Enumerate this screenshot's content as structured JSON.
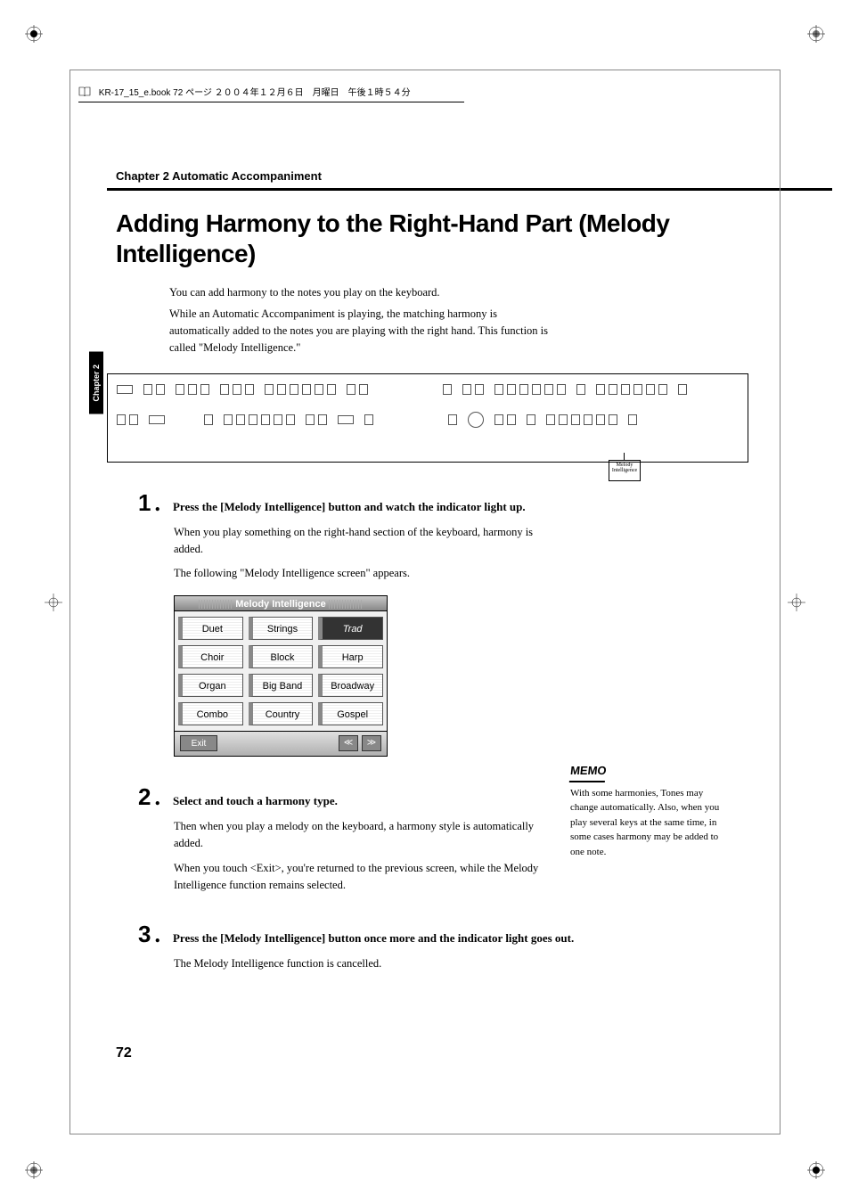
{
  "header_line": "KR-17_15_e.book  72 ページ  ２００４年１２月６日　月曜日　午後１時５４分",
  "chapter_header": "Chapter 2 Automatic Accompaniment",
  "main_title": "Adding Harmony to the Right-Hand Part (Melody Intelligence)",
  "intro": {
    "p1": "You can add harmony to the notes you play on the keyboard.",
    "p2": "While an Automatic Accompaniment is playing, the matching harmony is automatically added to the notes you are playing with the right hand. This function is called \"Melody Intelligence.\""
  },
  "side_tab": "Chapter 2",
  "callout_label": "Melody Intelligence",
  "steps": {
    "s1": {
      "num": "1",
      "title": "Press the [Melody Intelligence] button and watch the indicator light up.",
      "body1": "When you play something on the right-hand section of the keyboard, harmony is added.",
      "body2": "The following \"Melody Intelligence screen\" appears."
    },
    "s2": {
      "num": "2",
      "title": "Select and touch a harmony type.",
      "body1": "Then when you play a melody on the keyboard, a harmony style is automatically added.",
      "body2": "When you touch <Exit>, you're returned to the previous screen, while the Melody Intelligence function remains selected."
    },
    "s3": {
      "num": "3",
      "title": "Press the [Melody Intelligence] button once more and the indicator light goes out.",
      "body1": "The Melody Intelligence function is cancelled."
    }
  },
  "screen": {
    "title": "Melody Intelligence",
    "cells": [
      "Duet",
      "Strings",
      "Trad",
      "Choir",
      "Block",
      "Harp",
      "Organ",
      "Big Band",
      "Broadway",
      "Combo",
      "Country",
      "Gospel"
    ],
    "selected_index": 2,
    "exit": "Exit",
    "prev": "≪",
    "next": "≫"
  },
  "memo": {
    "label": "MEMO",
    "text": "With some harmonies, Tones may change automatically. Also, when you play several keys at the same time, in some cases harmony may be added to one note."
  },
  "page_number": "72"
}
